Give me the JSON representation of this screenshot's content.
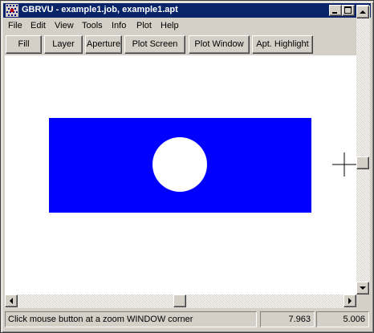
{
  "window": {
    "title": "GBRVU - example1.job, example1.apt"
  },
  "menu": {
    "items": [
      "File",
      "Edit",
      "View",
      "Tools",
      "Info",
      "Plot",
      "Help"
    ]
  },
  "toolbar": {
    "buttons": [
      "Fill",
      "Layer",
      "Aperture",
      "Plot Screen",
      "Plot Window",
      "Apt. Highlight"
    ]
  },
  "canvas": {
    "background_color": "#ffffff",
    "pad_color": "#0000ff",
    "hole_color": "#ffffff",
    "cursor": "crosshair-icon"
  },
  "status": {
    "message": "Click mouse button at a zoom WINDOW corner",
    "x_coord": "7.963",
    "y_coord": "5.006"
  },
  "colors": {
    "titlebar": "#0a246a",
    "face": "#d4d0c8"
  }
}
